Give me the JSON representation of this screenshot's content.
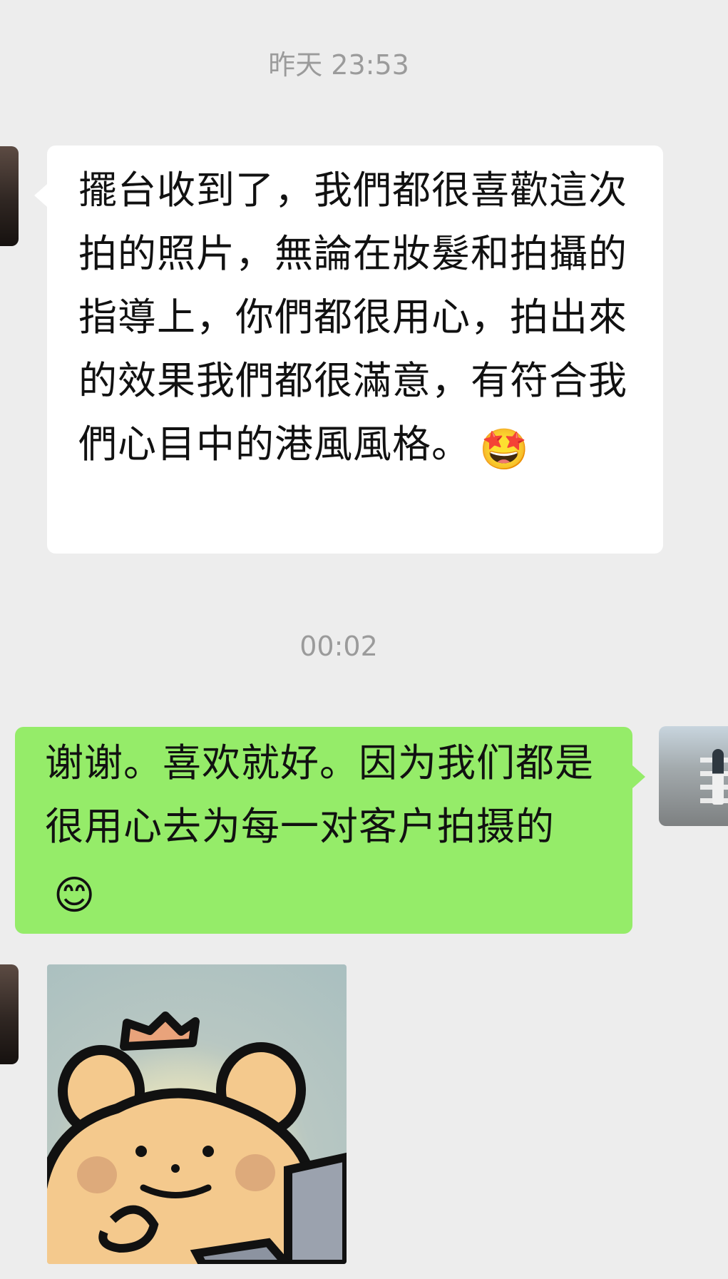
{
  "messages": {
    "time_first": "昨天 23:53",
    "incoming_text": "擺台收到了，我們都很喜歡這次拍的照片，無論在妝髮和拍攝的指導上，你們都很用心，拍出來的效果我們都很滿意，有符合我們心目中的港風風格。",
    "incoming_emoji": "🤩",
    "time_second": "00:02",
    "outgoing_text": "谢谢。喜欢就好。因为我们都是很用心去为每一对客户拍摄的",
    "outgoing_emoji": "😊"
  },
  "icons": {
    "incoming_avatar": "contact-avatar",
    "outgoing_avatar": "user-avatar",
    "sticker": "bear-laptop-sticker"
  },
  "colors": {
    "background": "#ededed",
    "incoming_bubble": "#ffffff",
    "outgoing_bubble": "#95ec69",
    "timestamp": "#9b9b9b"
  }
}
